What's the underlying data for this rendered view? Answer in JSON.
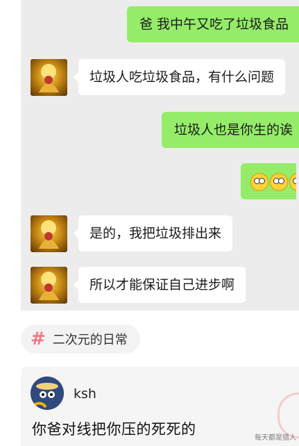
{
  "chat": {
    "messages": [
      {
        "side": "out",
        "text": "爸 我中午又吃了垃圾食品"
      },
      {
        "side": "in",
        "text": "垃圾人吃垃圾食品，有什么问题"
      },
      {
        "side": "out",
        "text": "垃圾人也是你生的诶"
      },
      {
        "side": "out",
        "emoji": "flushed-face",
        "count": 3
      },
      {
        "side": "in",
        "text": "是的，我把垃圾排出来"
      },
      {
        "side": "in",
        "text": "所以才能保证自己进步啊"
      }
    ]
  },
  "topic": {
    "hash": "#",
    "label": "二次元的日常"
  },
  "comment": {
    "author": "ksh",
    "text": "你爸对线把你压的死死的"
  },
  "watermark": "每天都是猎人",
  "colors": {
    "chat_bg": "#ececec",
    "out_bubble": "#95ec69",
    "in_bubble": "#ffffff",
    "tag_hash": "#f07a86"
  }
}
